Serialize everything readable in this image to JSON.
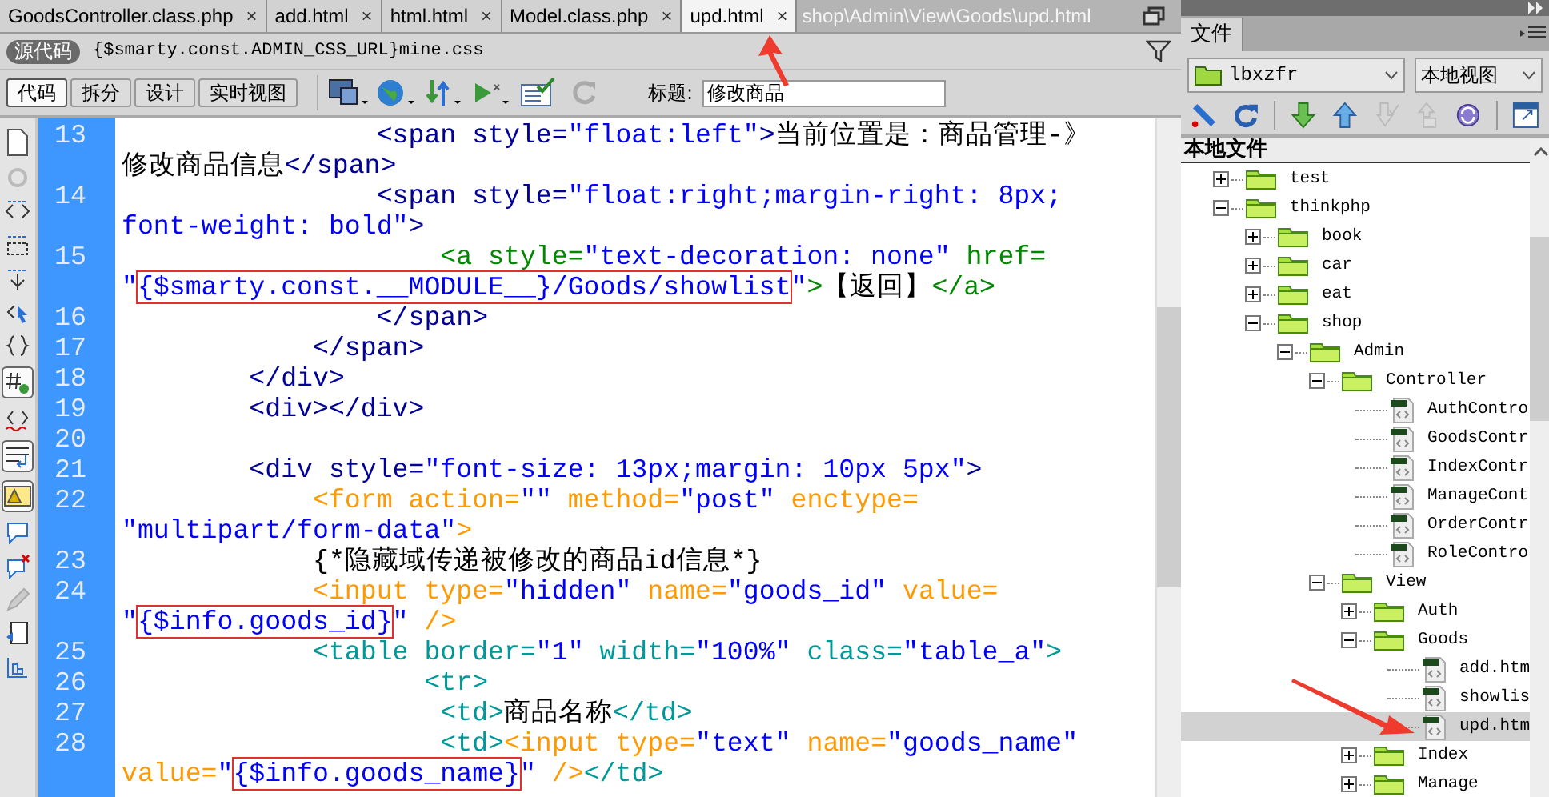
{
  "tabs": [
    {
      "label": "GoodsController.class.php",
      "close": "×",
      "selected": false
    },
    {
      "label": "add.html",
      "close": "×",
      "selected": false
    },
    {
      "label": "html.html",
      "close": "×",
      "selected": false
    },
    {
      "label": "Model.class.php",
      "close": "×",
      "selected": false
    },
    {
      "label": "upd.html",
      "close": "×",
      "selected": true
    }
  ],
  "file_path": "shop\\Admin\\View\\Goods\\upd.html",
  "related_files": {
    "source_label": "源代码",
    "file": "{$smarty.const.ADMIN_CSS_URL}mine.css"
  },
  "view_buttons": [
    {
      "label": "代码",
      "selected": true
    },
    {
      "label": "拆分",
      "selected": false
    },
    {
      "label": "设计",
      "selected": false
    },
    {
      "label": "实时视图",
      "selected": false
    }
  ],
  "title_field": {
    "label": "标题:",
    "value": "修改商品"
  },
  "code_lines": [
    {
      "number": "13",
      "rows": [
        {
          "segments": [
            {
              "text": "                <span style=",
              "kind": "tag"
            },
            {
              "text": "\"float:left\"",
              "kind": "value"
            },
            {
              "text": ">",
              "kind": "tag"
            },
            {
              "text": "当前位置是：商品管理-》",
              "kind": "plain"
            }
          ]
        },
        {
          "segments": [
            {
              "text": "修改商品信息",
              "kind": "plain"
            },
            {
              "text": "</span>",
              "kind": "tag"
            }
          ]
        }
      ]
    },
    {
      "number": "14",
      "rows": [
        {
          "segments": [
            {
              "text": "                <span style=",
              "kind": "tag"
            },
            {
              "text": "\"float:right;margin-right: 8px;",
              "kind": "value"
            }
          ]
        },
        {
          "segments": [
            {
              "text": "font-weight: bold\"",
              "kind": "value"
            },
            {
              "text": ">",
              "kind": "tag"
            }
          ]
        }
      ]
    },
    {
      "number": "15",
      "rows": [
        {
          "segments": [
            {
              "text": "                    <a style=",
              "kind": "anchor"
            },
            {
              "text": "\"text-decoration: none\"",
              "kind": "value"
            },
            {
              "text": " href=",
              "kind": "anchor"
            }
          ]
        },
        {
          "segments": [
            {
              "text": "\"",
              "kind": "value"
            },
            {
              "text": "{$smarty.const.__MODULE__}/Goods/showlist",
              "kind": "marked"
            },
            {
              "text": "\"",
              "kind": "value"
            },
            {
              "text": ">",
              "kind": "anchor"
            },
            {
              "text": "【返回】",
              "kind": "plain"
            },
            {
              "text": "</a>",
              "kind": "anchor"
            }
          ]
        }
      ]
    },
    {
      "number": "16",
      "rows": [
        {
          "segments": [
            {
              "text": "                </span>",
              "kind": "tag"
            }
          ]
        }
      ]
    },
    {
      "number": "17",
      "rows": [
        {
          "segments": [
            {
              "text": "            </span>",
              "kind": "tag"
            }
          ]
        }
      ]
    },
    {
      "number": "18",
      "rows": [
        {
          "segments": [
            {
              "text": "        </div>",
              "kind": "tag"
            }
          ]
        }
      ]
    },
    {
      "number": "19",
      "rows": [
        {
          "segments": [
            {
              "text": "        <div></div>",
              "kind": "tag"
            }
          ]
        }
      ]
    },
    {
      "number": "20"
    },
    {
      "number": "21",
      "rows": [
        {
          "segments": [
            {
              "text": "        <div style=",
              "kind": "tag"
            },
            {
              "text": "\"font-size: 13px;margin: 10px 5px\"",
              "kind": "value"
            },
            {
              "text": ">",
              "kind": "tag"
            }
          ]
        }
      ]
    },
    {
      "number": "22",
      "rows": [
        {
          "segments": [
            {
              "text": "            <form action=",
              "kind": "form"
            },
            {
              "text": "\"\"",
              "kind": "value"
            },
            {
              "text": " method=",
              "kind": "form"
            },
            {
              "text": "\"post\"",
              "kind": "value"
            },
            {
              "text": " enctype=",
              "kind": "form"
            }
          ]
        },
        {
          "segments": [
            {
              "text": "\"multipart/form-data\"",
              "kind": "value"
            },
            {
              "text": ">",
              "kind": "form"
            }
          ]
        }
      ]
    },
    {
      "number": "23",
      "rows": [
        {
          "segments": [
            {
              "text": "            {*隐藏域传递被修改的商品id信息*}",
              "kind": "plain"
            }
          ]
        }
      ]
    },
    {
      "number": "24",
      "rows": [
        {
          "segments": [
            {
              "text": "            <input type=",
              "kind": "form"
            },
            {
              "text": "\"hidden\"",
              "kind": "value"
            },
            {
              "text": " name=",
              "kind": "form"
            },
            {
              "text": "\"goods_id\"",
              "kind": "value"
            },
            {
              "text": " value=",
              "kind": "form"
            }
          ]
        },
        {
          "segments": [
            {
              "text": "\"",
              "kind": "value"
            },
            {
              "text": "{$info.goods_id}",
              "kind": "marked"
            },
            {
              "text": "\"",
              "kind": "value"
            },
            {
              "text": " />",
              "kind": "form"
            }
          ]
        }
      ]
    },
    {
      "number": "25",
      "rows": [
        {
          "segments": [
            {
              "text": "            <table border=",
              "kind": "table"
            },
            {
              "text": "\"1\"",
              "kind": "value"
            },
            {
              "text": " width=",
              "kind": "table"
            },
            {
              "text": "\"100%\"",
              "kind": "value"
            },
            {
              "text": " class=",
              "kind": "table"
            },
            {
              "text": "\"table_a\"",
              "kind": "value"
            },
            {
              "text": ">",
              "kind": "table"
            }
          ]
        }
      ]
    },
    {
      "number": "26",
      "rows": [
        {
          "segments": [
            {
              "text": "                   <tr>",
              "kind": "table"
            }
          ]
        }
      ]
    },
    {
      "number": "27",
      "rows": [
        {
          "segments": [
            {
              "text": "                    <td>",
              "kind": "table"
            },
            {
              "text": "商品名称",
              "kind": "plain"
            },
            {
              "text": "</td>",
              "kind": "table"
            }
          ]
        }
      ]
    },
    {
      "number": "28",
      "rows": [
        {
          "segments": [
            {
              "text": "                    <td>",
              "kind": "table"
            },
            {
              "text": "<input type=",
              "kind": "form"
            },
            {
              "text": "\"text\"",
              "kind": "value"
            },
            {
              "text": " name=",
              "kind": "form"
            },
            {
              "text": "\"goods_name\"",
              "kind": "value"
            }
          ]
        },
        {
          "segments": [
            {
              "text": "value=",
              "kind": "form"
            },
            {
              "text": "\"",
              "kind": "value"
            },
            {
              "text": "{$info.goods_name}",
              "kind": "marked"
            },
            {
              "text": "\"",
              "kind": "value"
            },
            {
              "text": " />",
              "kind": "form"
            },
            {
              "text": "</td>",
              "kind": "table"
            }
          ]
        }
      ]
    }
  ],
  "files_panel": {
    "tab": "文件",
    "site": "lbxzfr",
    "view": "本地视图",
    "header": "本地文件",
    "tree": [
      {
        "name": "test",
        "kind": "folder",
        "expanded": false,
        "selected": false
      },
      {
        "name": "thinkphp",
        "kind": "folder",
        "expanded": true,
        "selected": false,
        "children": [
          {
            "name": "book",
            "kind": "folder",
            "expanded": false,
            "selected": false
          },
          {
            "name": "car",
            "kind": "folder",
            "expanded": false,
            "selected": false
          },
          {
            "name": "eat",
            "kind": "folder",
            "expanded": false,
            "selected": false
          },
          {
            "name": "shop",
            "kind": "folder",
            "expanded": true,
            "selected": false,
            "children": [
              {
                "name": "Admin",
                "kind": "folder",
                "expanded": true,
                "selected": false,
                "children": [
                  {
                    "name": "Controller",
                    "kind": "folder",
                    "expanded": true,
                    "selected": false,
                    "children": [
                      {
                        "name": "AuthContro",
                        "kind": "file",
                        "selected": false
                      },
                      {
                        "name": "GoodsContr",
                        "kind": "file",
                        "selected": false
                      },
                      {
                        "name": "IndexContr",
                        "kind": "file",
                        "selected": false
                      },
                      {
                        "name": "ManageCont",
                        "kind": "file",
                        "selected": false
                      },
                      {
                        "name": "OrderContr",
                        "kind": "file",
                        "selected": false
                      },
                      {
                        "name": "RoleContro",
                        "kind": "file",
                        "selected": false
                      }
                    ]
                  },
                  {
                    "name": "View",
                    "kind": "folder",
                    "expanded": true,
                    "selected": false,
                    "children": [
                      {
                        "name": "Auth",
                        "kind": "folder",
                        "expanded": false,
                        "selected": false
                      },
                      {
                        "name": "Goods",
                        "kind": "folder",
                        "expanded": true,
                        "selected": false,
                        "children": [
                          {
                            "name": "add.htm",
                            "kind": "file",
                            "selected": false
                          },
                          {
                            "name": "showlis",
                            "kind": "file",
                            "selected": false
                          },
                          {
                            "name": "upd.htm",
                            "kind": "file",
                            "selected": true
                          }
                        ]
                      },
                      {
                        "name": "Index",
                        "kind": "folder",
                        "expanded": false,
                        "selected": false
                      },
                      {
                        "name": "Manage",
                        "kind": "folder",
                        "expanded": false,
                        "selected": false
                      }
                    ]
                  }
                ]
              }
            ]
          }
        ]
      }
    ]
  }
}
